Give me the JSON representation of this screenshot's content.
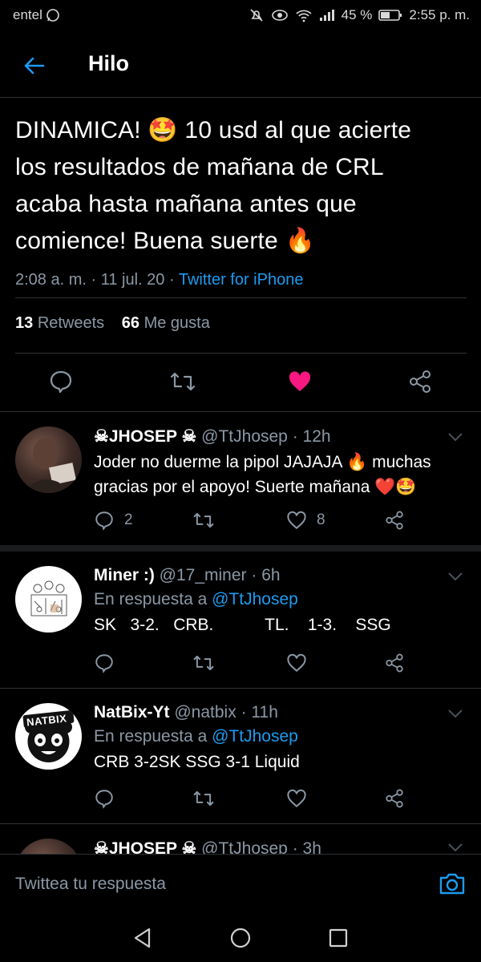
{
  "status_bar": {
    "carrier": "entel",
    "battery": "45 %",
    "time": "2:55 p. m."
  },
  "header": {
    "title": "Hilo"
  },
  "main_tweet": {
    "text_line1": "DINAMICA! 🤩 10 usd al que acierte",
    "text_line2": "los resultados de mañana de CRL",
    "text_line3": "acaba hasta mañana antes que",
    "text_line4": "comience! Buena suerte 🔥",
    "time": "2:08 a. m.",
    "date": "11 jul. 20",
    "source": "Twitter for iPhone",
    "retweets_count": "13",
    "retweets_label": "Retweets",
    "likes_count": "66",
    "likes_label": "Me gusta",
    "liked": true,
    "like_color": "#f91880"
  },
  "replies": [
    {
      "name": "☠JHOSEP ☠",
      "handle": "@TtJhosep",
      "age": "12h",
      "reply_to_label": "",
      "reply_to_handle": "",
      "text_line1": "Joder no duerme la pipol JAJAJA 🔥 muchas",
      "text_line2": "gracias por el apoyo! Suerte mañana ❤️🤩",
      "reply_count": "2",
      "retweet_count": "",
      "like_count": "8"
    },
    {
      "name": "Miner :)",
      "handle": "@17_miner",
      "age": "6h",
      "reply_to_label": "En respuesta a",
      "reply_to_handle": "@TtJhosep",
      "text_line1": "SK   3-2.   CRB.           TL.    1-3.    SSG",
      "reply_count": "",
      "retweet_count": "",
      "like_count": ""
    },
    {
      "name": "NatBix-Yt",
      "handle": "@natbix",
      "age": "11h",
      "reply_to_label": "En respuesta a",
      "reply_to_handle": "@TtJhosep",
      "text_line1": "CRB 3-2SK SSG 3-1 Liquid",
      "reply_count": "",
      "retweet_count": "",
      "like_count": "",
      "avatar_text": "NATBIX"
    },
    {
      "name": "☠JHOSEP ☠",
      "handle": "@TtJhosep",
      "age": "3h"
    }
  ],
  "compose": {
    "placeholder": "Twittea tu respuesta"
  },
  "colors": {
    "accent": "#1d9bf0",
    "muted": "#8b98a5",
    "like": "#f91880",
    "background": "#000000"
  }
}
